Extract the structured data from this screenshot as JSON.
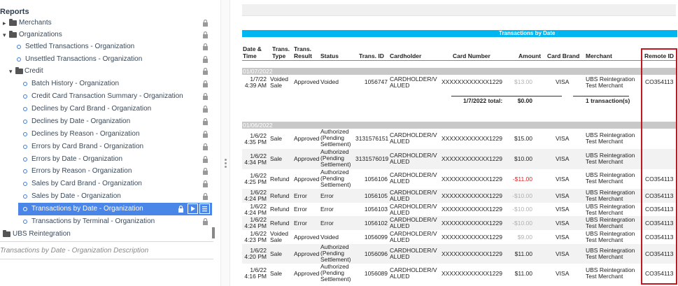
{
  "tree": {
    "title": "Reports",
    "items": [
      {
        "label": "Merchants"
      },
      {
        "label": "Organizations"
      },
      {
        "label": "Settled Transactions - Organization"
      },
      {
        "label": "Unsettled Transactions - Organization"
      },
      {
        "label": "Credit"
      },
      {
        "label": "Batch History - Organization"
      },
      {
        "label": "Credit Card Transaction Summary - Organization"
      },
      {
        "label": "Declines by Card Brand - Organization"
      },
      {
        "label": "Declines by Date - Organization"
      },
      {
        "label": "Declines by Reason - Organization"
      },
      {
        "label": "Errors by Card Brand - Organization"
      },
      {
        "label": "Errors by Date - Organization"
      },
      {
        "label": "Errors by Reason - Organization"
      },
      {
        "label": "Sales by Card Brand - Organization"
      },
      {
        "label": "Sales by Date - Organization"
      },
      {
        "label": "Transactions by Date - Organization"
      },
      {
        "label": "Transactions by Terminal - Organization"
      },
      {
        "label": "UBS Reintegration"
      }
    ],
    "description": "Transactions by Date - Organization Description"
  },
  "report": {
    "banner": "Transactions by Date",
    "headers": {
      "date": [
        "Date &",
        "Time"
      ],
      "type": [
        "Trans.",
        "Type"
      ],
      "result": [
        "Trans.",
        "Result"
      ],
      "status": "Status",
      "tid": "Trans. ID",
      "holder": "Cardholder",
      "card": "Card Number",
      "amount": "Amount",
      "brand": "Card Brand",
      "merchant": "Merchant",
      "remote": "Remote ID"
    },
    "groups": [
      {
        "date": "01/07/2022",
        "rows": [
          {
            "d1": "1/7/22",
            "d2": "4:39 AM",
            "type": "Voided Sale",
            "result": "Approved",
            "status": "Voided",
            "tid": "1056747",
            "holder": "CARDHOLDER/V ALUED",
            "card": "XXXXXXXXXXXX1229",
            "amount": "$13.00",
            "brand": "VISA",
            "merchant": "UBS Reintegration Test Merchant",
            "rid": "CO354113"
          }
        ],
        "total": {
          "label": "1/7/2022 total:",
          "amount": "$0.00",
          "count": "1 transaction(s)"
        }
      },
      {
        "date": "01/06/2022",
        "rows": [
          {
            "d1": "1/6/22",
            "d2": "4:35 PM",
            "type": "Sale",
            "result": "Approved",
            "status": "Authorized (Pending Settlement)",
            "tid": "3131576151",
            "holder": "CARDHOLDER/V ALUED",
            "card": "XXXXXXXXXXXX1229",
            "amount": "$15.00",
            "brand": "VISA",
            "merchant": "UBS Reintegration Test Merchant",
            "rid": ""
          },
          {
            "d1": "1/6/22",
            "d2": "4:34 PM",
            "type": "Sale",
            "result": "Approved",
            "status": "Authorized (Pending Settlement)",
            "tid": "3131576019",
            "holder": "CARDHOLDER/V ALUED",
            "card": "XXXXXXXXXXXX1229",
            "amount": "$10.00",
            "brand": "VISA",
            "merchant": "UBS Reintegration Test Merchant",
            "rid": ""
          },
          {
            "d1": "1/6/22",
            "d2": "4:25 PM",
            "type": "Refund",
            "result": "Approved",
            "status": "Authorized (Pending Settlement)",
            "tid": "1056106",
            "holder": "CARDHOLDER/V ALUED",
            "card": "XXXXXXXXXXXX1229",
            "amount": "-$11.00",
            "brand": "VISA",
            "merchant": "UBS Reintegration Test Merchant",
            "rid": "CO354113"
          },
          {
            "d1": "1/6/22",
            "d2": "4:24 PM",
            "type": "Refund",
            "result": "Error",
            "status": "Error",
            "tid": "1056105",
            "holder": "CARDHOLDER/V ALUED",
            "card": "XXXXXXXXXXXX1229",
            "amount": "-$10.00",
            "brand": "VISA",
            "merchant": "UBS Reintegration Test Merchant",
            "rid": "CO354113"
          },
          {
            "d1": "1/6/22",
            "d2": "4:24 PM",
            "type": "Refund",
            "result": "Error",
            "status": "Error",
            "tid": "1056103",
            "holder": "CARDHOLDER/V ALUED",
            "card": "XXXXXXXXXXXX1229",
            "amount": "-$10.00",
            "brand": "VISA",
            "merchant": "UBS Reintegration Test Merchant",
            "rid": "CO354113"
          },
          {
            "d1": "1/6/22",
            "d2": "4:24 PM",
            "type": "Refund",
            "result": "Error",
            "status": "Error",
            "tid": "1056102",
            "holder": "CARDHOLDER/V ALUED",
            "card": "XXXXXXXXXXXX1229",
            "amount": "-$10.00",
            "brand": "VISA",
            "merchant": "UBS Reintegration Test Merchant",
            "rid": "CO354113"
          },
          {
            "d1": "1/6/22",
            "d2": "4:23 PM",
            "type": "Voided Sale",
            "result": "Approved",
            "status": "Voided",
            "tid": "1056099",
            "holder": "CARDHOLDER/V ALUED",
            "card": "XXXXXXXXXXXX1229",
            "amount": "$9.00",
            "brand": "VISA",
            "merchant": "UBS Reintegration Test Merchant",
            "rid": "CO354113"
          },
          {
            "d1": "1/6/22",
            "d2": "4:20 PM",
            "type": "Sale",
            "result": "Approved",
            "status": "Authorized (Pending Settlement)",
            "tid": "1056096",
            "holder": "CARDHOLDER/V ALUED",
            "card": "XXXXXXXXXXXX1229",
            "amount": "$11.00",
            "brand": "VISA",
            "merchant": "UBS Reintegration Test Merchant",
            "rid": "CO354113"
          },
          {
            "d1": "1/6/22",
            "d2": "4:16 PM",
            "type": "Sale",
            "result": "Approved",
            "status": "Authorized (Pending Settlement)",
            "tid": "1056089",
            "holder": "CARDHOLDER/V ALUED",
            "card": "XXXXXXXXXXXX1229",
            "amount": "$11.00",
            "brand": "VISA",
            "merchant": "UBS Reintegration Test Merchant",
            "rid": "CO354113"
          }
        ]
      }
    ]
  },
  "colors": {
    "accent": "#4a86e8",
    "banner": "#00b6f0",
    "negative": "#e02020",
    "highlight_box": "#c0181e"
  }
}
